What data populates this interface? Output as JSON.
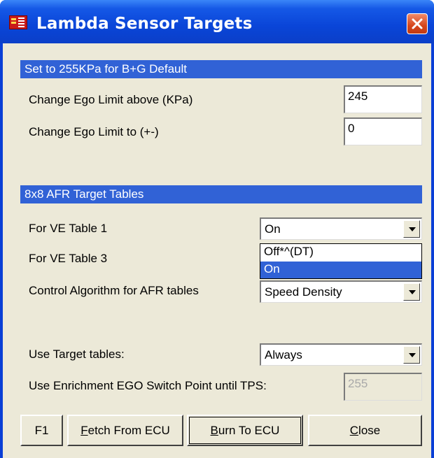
{
  "window": {
    "title": "Lambda Sensor Targets",
    "colors": {
      "titlebar": "#0a45d8",
      "header_band": "#3162d6",
      "close": "#d6461c"
    }
  },
  "section1": {
    "header": "Set to 255KPa for B+G Default",
    "rows": [
      {
        "label": "Change Ego Limit above (KPa)",
        "value": "245"
      },
      {
        "label": "Change Ego Limit to (+-)",
        "value": "0"
      }
    ]
  },
  "section2": {
    "header": "8x8 AFR Target Tables",
    "ve_table1": {
      "label": "For VE Table 1",
      "value": "On"
    },
    "ve_table3": {
      "label": "For VE Table 3"
    },
    "dropdown_options": [
      "Off*^(DT)",
      "On"
    ],
    "dropdown_selected": "On",
    "control_algorithm": {
      "label": "Control Algorithm for AFR tables",
      "value": "Speed Density"
    },
    "use_target_tables": {
      "label": "Use Target tables:",
      "value": "Always"
    },
    "enrichment": {
      "label": "Use Enrichment EGO Switch Point until TPS:",
      "value": "255"
    }
  },
  "buttons": {
    "f1": "F1",
    "fetch": {
      "mnemonic": "F",
      "rest": "etch From ECU"
    },
    "burn": {
      "mnemonic": "B",
      "rest": "urn To ECU"
    },
    "close": {
      "mnemonic": "C",
      "rest": "lose"
    }
  },
  "icons": {
    "app": "app-icon",
    "close": "close-icon",
    "dropdown": "chevron-down-icon"
  }
}
